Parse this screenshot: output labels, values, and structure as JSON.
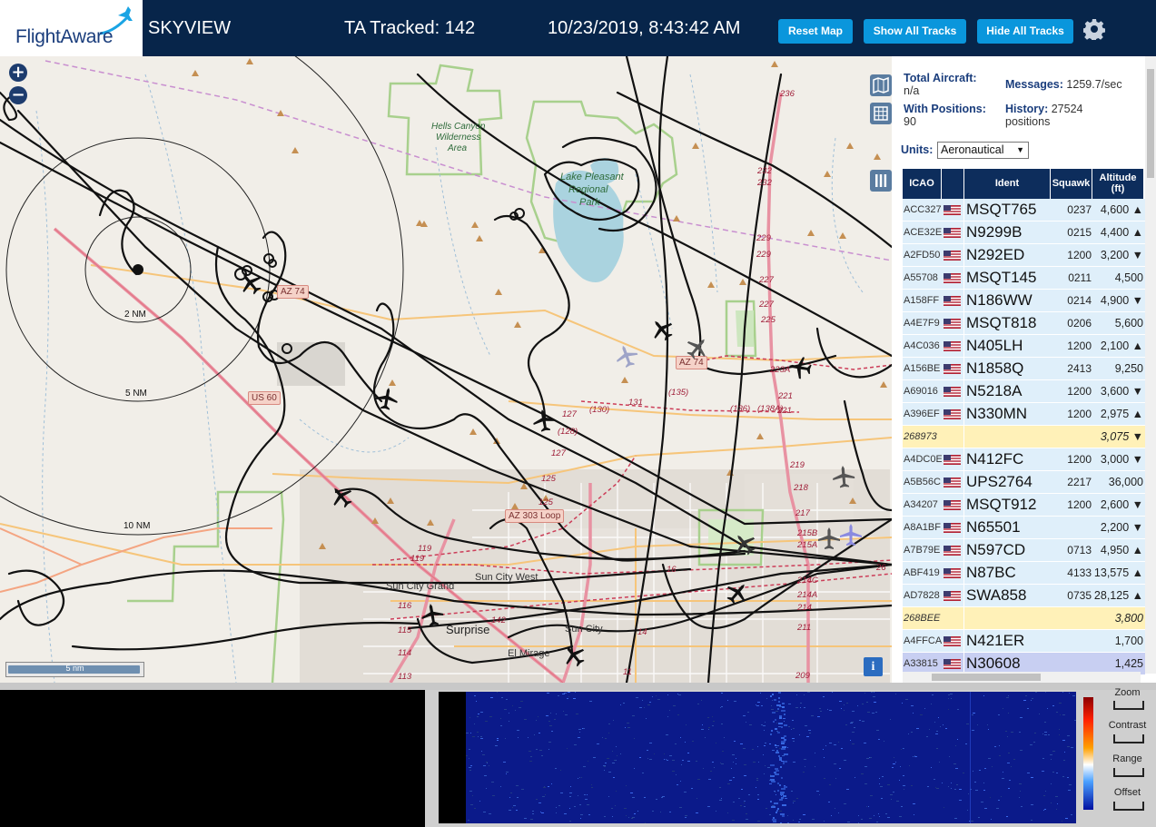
{
  "header": {
    "logo_text": "FlightAware",
    "app_title": "SKYVIEW",
    "ta_tracked": "TA Tracked: 142",
    "datetime": "10/23/2019, 8:43:42 AM",
    "buttons": {
      "reset": "Reset Map",
      "show_all": "Show All Tracks",
      "hide_all": "Hide All Tracks"
    },
    "settings_icon": "gear-icon"
  },
  "map": {
    "zoom_in": "+",
    "zoom_out": "−",
    "info": "i",
    "scale_label": "5 nm",
    "range_rings": [
      "2 NM",
      "5 NM",
      "10 NM"
    ],
    "places": [
      "Hells Canyon",
      "Wilderness",
      "Area",
      "Lake Pleasant",
      "Regional",
      "Park",
      "Sun City Grand",
      "Sun City West",
      "Surprise",
      "Sun City",
      "El Mirage"
    ],
    "road_shields": [
      "AZ 74",
      "AZ 74",
      "US 60",
      "AZ 303 Loop"
    ],
    "road_numbers": [
      "236",
      "232",
      "232",
      "229",
      "229",
      "227",
      "227",
      "225",
      "223A",
      "221",
      "221",
      "219",
      "218",
      "217",
      "215B",
      "215A",
      "214C",
      "214A",
      "214",
      "211",
      "209",
      "(135)",
      "(136)",
      "(138A)",
      "(130)",
      "131",
      "(128)",
      "127",
      "127",
      "125",
      "125",
      "119",
      "119",
      "116",
      "115",
      "114",
      "113",
      "142",
      "16",
      "14",
      "11",
      "26"
    ],
    "colors": {
      "land": "#f1eee8",
      "water": "#aad3df",
      "park_border": "#a8d08d",
      "track": "#111111",
      "highway": "#e892a2",
      "arterial": "#f6c57a"
    }
  },
  "sidebar": {
    "total_aircraft_label": "Total Aircraft:",
    "total_aircraft_value": "n/a",
    "with_positions_label": "With Positions:",
    "with_positions_value": "90",
    "messages_label": "Messages:",
    "messages_value": "1259.7/sec",
    "history_label": "History:",
    "history_value": "27524",
    "history_unit": "positions",
    "units_label": "Units:",
    "units_value": "Aeronautical",
    "columns": [
      "ICAO",
      "",
      "Ident",
      "Squawk",
      "Altitude (ft)"
    ],
    "rows": [
      {
        "icao": "ACC327",
        "ident": "MSQT765",
        "squawk": "0237",
        "alt": "4,600 ▲",
        "style": ""
      },
      {
        "icao": "ACE32E",
        "ident": "N9299B",
        "squawk": "0215",
        "alt": "4,400 ▲",
        "style": ""
      },
      {
        "icao": "A2FD50",
        "ident": "N292ED",
        "squawk": "1200",
        "alt": "3,200 ▼",
        "style": ""
      },
      {
        "icao": "A55708",
        "ident": "MSQT145",
        "squawk": "0211",
        "alt": "4,500",
        "style": ""
      },
      {
        "icao": "A158FF",
        "ident": "N186WW",
        "squawk": "0214",
        "alt": "4,900 ▼",
        "style": ""
      },
      {
        "icao": "A4E7F9",
        "ident": "MSQT818",
        "squawk": "0206",
        "alt": "5,600",
        "style": ""
      },
      {
        "icao": "A4C036",
        "ident": "N405LH",
        "squawk": "1200",
        "alt": "2,100 ▲",
        "style": ""
      },
      {
        "icao": "A156BE",
        "ident": "N1858Q",
        "squawk": "2413",
        "alt": "9,250",
        "style": ""
      },
      {
        "icao": "A69016",
        "ident": "N5218A",
        "squawk": "1200",
        "alt": "3,600 ▼",
        "style": ""
      },
      {
        "icao": "A396EF",
        "ident": "N330MN",
        "squawk": "1200",
        "alt": "2,975 ▲",
        "style": ""
      },
      {
        "icao": "268973",
        "ident": "",
        "squawk": "",
        "alt": "3,075 ▼",
        "style": "yellow"
      },
      {
        "icao": "A4DC0E",
        "ident": "N412FC",
        "squawk": "1200",
        "alt": "3,000 ▼",
        "style": ""
      },
      {
        "icao": "A5B56C",
        "ident": "UPS2764",
        "squawk": "2217",
        "alt": "36,000",
        "style": ""
      },
      {
        "icao": "A34207",
        "ident": "MSQT912",
        "squawk": "1200",
        "alt": "2,600 ▼",
        "style": ""
      },
      {
        "icao": "A8A1BF",
        "ident": "N65501",
        "squawk": "",
        "alt": "2,200 ▼",
        "style": ""
      },
      {
        "icao": "A7B79E",
        "ident": "N597CD",
        "squawk": "0713",
        "alt": "4,950 ▲",
        "style": ""
      },
      {
        "icao": "ABF419",
        "ident": "N87BC",
        "squawk": "4133",
        "alt": "13,575 ▲",
        "style": ""
      },
      {
        "icao": "AD7828",
        "ident": "SWA858",
        "squawk": "0735",
        "alt": "28,125 ▲",
        "style": ""
      },
      {
        "icao": "268BEE",
        "ident": "",
        "squawk": "",
        "alt": "3,800",
        "style": "yellow"
      },
      {
        "icao": "A4FFCA",
        "ident": "N421ER",
        "squawk": "",
        "alt": "1,700",
        "style": ""
      },
      {
        "icao": "A33815",
        "ident": "N30608",
        "squawk": "",
        "alt": "1,425",
        "style": "sel"
      }
    ]
  },
  "spectrum": {
    "controls": [
      "Zoom",
      "Contrast",
      "Range",
      "Offset"
    ]
  }
}
